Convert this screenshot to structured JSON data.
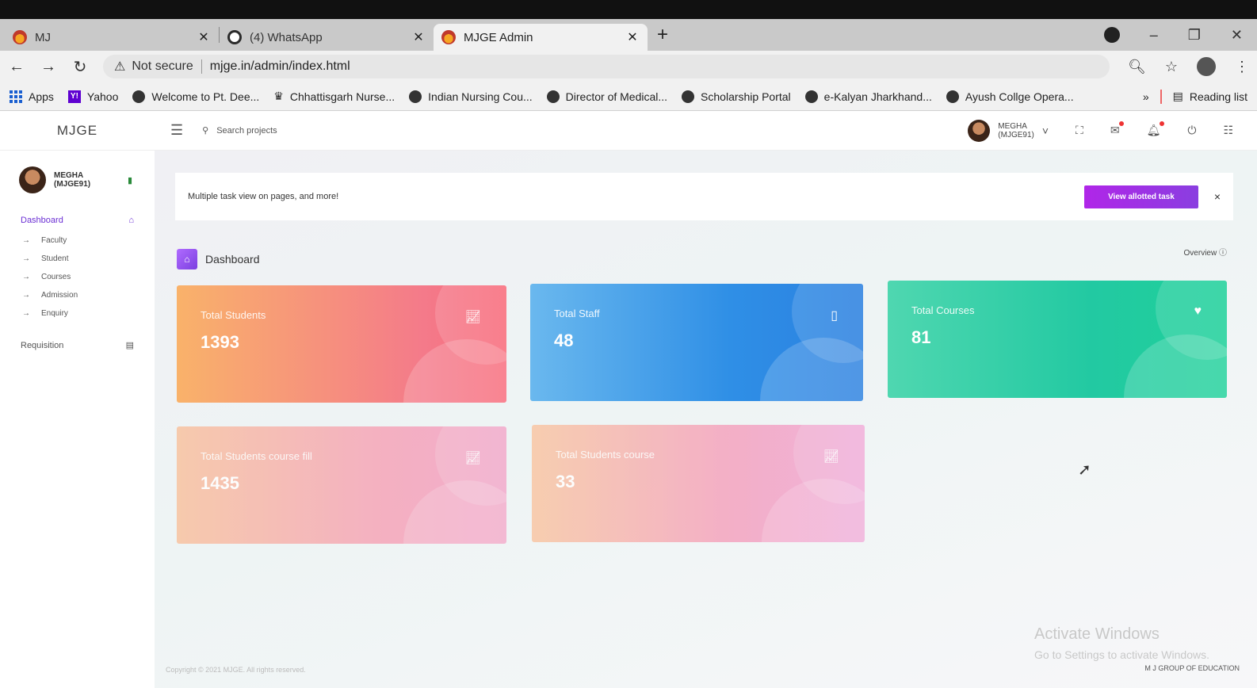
{
  "browser": {
    "tabs": [
      {
        "title": "MJ",
        "active": false
      },
      {
        "title": "(4) WhatsApp",
        "active": false
      },
      {
        "title": "MJGE Admin",
        "active": true
      }
    ],
    "new_tab": "+",
    "address": {
      "security": "Not secure",
      "url": "mjge.in/admin/index.html"
    },
    "bookmarks": [
      "Apps",
      "Yahoo",
      "Welcome to Pt. Dee...",
      "Chhattisgarh Nurse...",
      "Indian Nursing Cou...",
      "Director of Medical...",
      "Scholarship Portal",
      "e-Kalyan Jharkhand...",
      "Ayush Collge Opera..."
    ],
    "bookmarks_more": "»",
    "reading_list": "Reading list"
  },
  "app": {
    "brand": "MJGE",
    "search_placeholder": "Search projects",
    "user": {
      "name_line1": "MEGHA",
      "name_line2": "(MJGE91)"
    },
    "sidebar": {
      "dashboard": "Dashboard",
      "items": [
        "Faculty",
        "Student",
        "Courses",
        "Admission",
        "Enquiry"
      ],
      "requisition": "Requisition"
    },
    "notice": {
      "text": "Multiple task view on pages, and more!",
      "button": "View allotted task",
      "close": "×"
    },
    "page_title": "Dashboard",
    "overview": "Overview",
    "cards": [
      {
        "label": "Total Students",
        "value": "1393",
        "icon": "chart-icon"
      },
      {
        "label": "Total Staff",
        "value": "48",
        "icon": "bookmark-icon"
      },
      {
        "label": "Total Courses",
        "value": "81",
        "icon": "heart-icon"
      },
      {
        "label": "Total Students course fill",
        "value": "1435",
        "icon": "chart-icon"
      },
      {
        "label": "Total Students course",
        "value": "33",
        "icon": "chart-icon"
      }
    ],
    "footer_left": "Copyright © 2021 MJGE. All rights reserved.",
    "footer_right": "M J GROUP OF EDUCATION",
    "activate": {
      "line1": "Activate Windows",
      "line2": "Go to Settings to activate Windows."
    }
  }
}
